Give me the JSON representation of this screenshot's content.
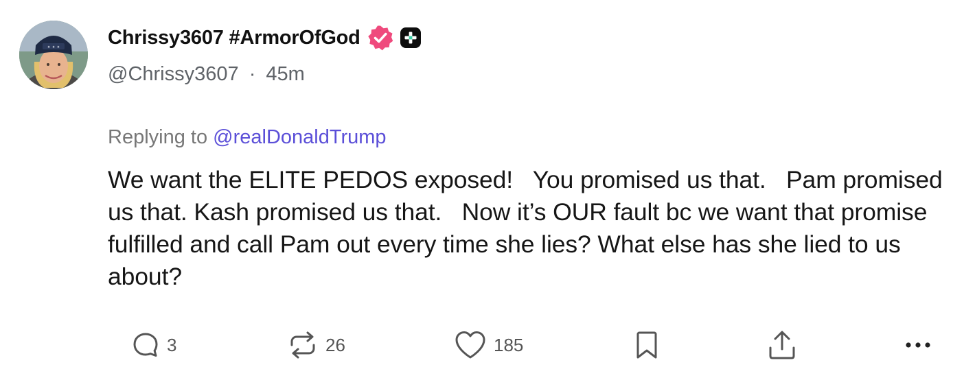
{
  "post": {
    "author": {
      "display_name": "Chrissy3607 #ArmorOfGod",
      "handle": "@Chrissy3607",
      "verified_icon": "verified-badge-icon",
      "badge_icon": "plus-badge-icon"
    },
    "separator": "·",
    "time_ago": "45m",
    "replying_prefix": "Replying to",
    "replying_handle": "@realDonaldTrump",
    "body": "We want the ELITE PEDOS exposed!   You promised us that.   Pam promised us that. Kash promised us that.   Now it’s OUR fault bc we want that promise fulfilled and call Pam out every time she lies? What else has she lied to us about?",
    "actions": {
      "reply_count": "3",
      "repost_count": "26",
      "like_count": "185"
    }
  },
  "colors": {
    "verified_badge": "#ef4a7d",
    "mention_link": "#5b4fd8",
    "text_primary": "#161616",
    "text_secondary": "#5f6368",
    "icon": "#555555"
  }
}
